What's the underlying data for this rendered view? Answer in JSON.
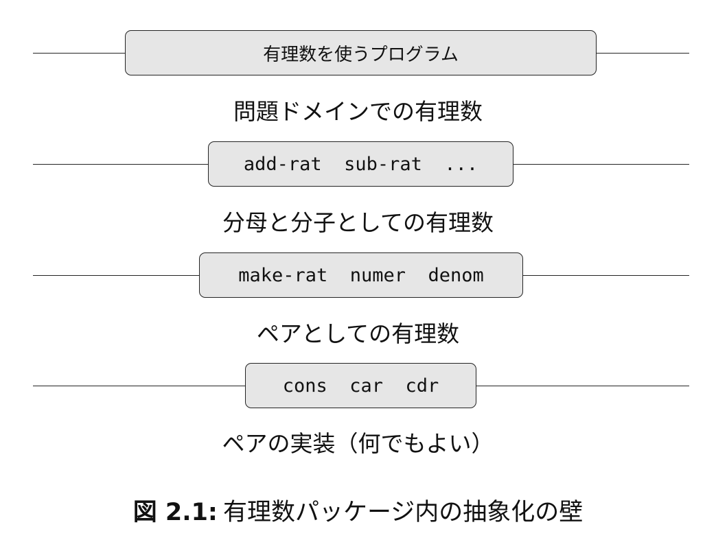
{
  "layers": [
    {
      "box": "有理数を使うプログラム",
      "label": "問題ドメインでの有理数"
    },
    {
      "box": "add-rat  sub-rat  ...",
      "label": "分母と分子としての有理数"
    },
    {
      "box": "make-rat  numer  denom",
      "label": "ペアとしての有理数"
    },
    {
      "box": "cons  car  cdr",
      "label": "ペアの実装（何でもよい）"
    }
  ],
  "caption": {
    "number": "図 2.1:",
    "text": "有理数パッケージ内の抽象化の壁"
  }
}
